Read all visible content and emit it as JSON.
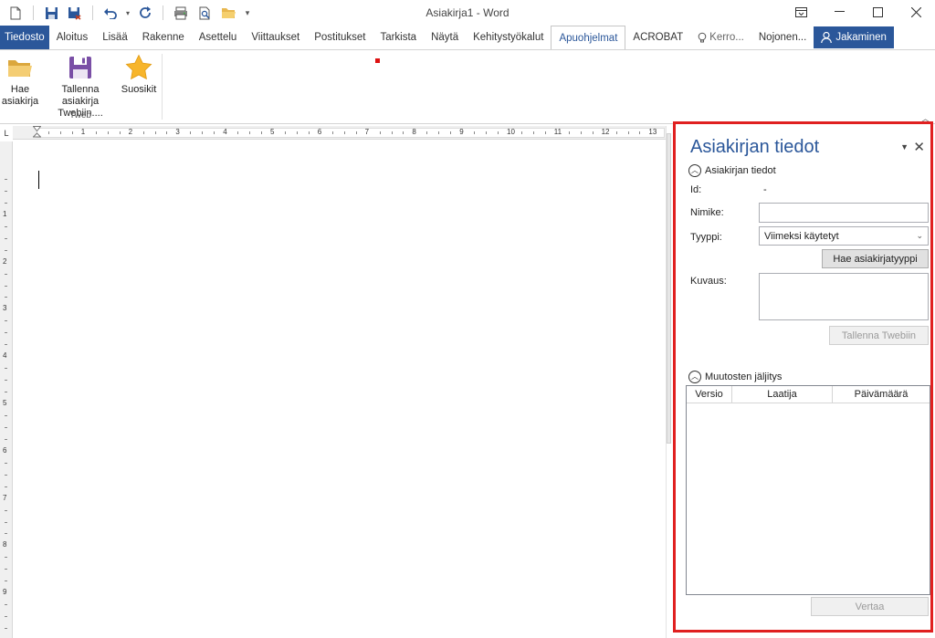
{
  "window": {
    "title": "Asiakirja1 - Word",
    "controls": [
      "ribbon-display-options",
      "minimize",
      "maximize",
      "close"
    ]
  },
  "quick_access": {
    "icons": [
      "new-document-icon",
      "save-icon",
      "save-as-icon",
      "undo-icon",
      "redo-icon",
      "print-icon",
      "print-preview-icon",
      "open-folder-icon",
      "customize-arrow-icon"
    ]
  },
  "ribbon_tabs": {
    "file": "Tiedosto",
    "items": [
      "Aloitus",
      "Lisää",
      "Rakenne",
      "Asettelu",
      "Viittaukset",
      "Postitukset",
      "Tarkista",
      "Näytä",
      "Kehitystyökalut"
    ],
    "active": "Apuohjelmat",
    "after": [
      "ACROBAT"
    ],
    "tell_me": "Kerro...",
    "user": "Nojonen...",
    "share": "Jakaminen"
  },
  "ribbon": {
    "buttons": [
      {
        "line1": "Hae",
        "line2": "asiakirja",
        "icon": "open-folder-icon"
      },
      {
        "line1": "Tallenna asiakirja",
        "line2": "Twebiin....",
        "icon": "save-floppy-icon"
      },
      {
        "line1": "Suosikit",
        "line2": "",
        "icon": "star-icon"
      }
    ],
    "group_label": "Tweb"
  },
  "ruler": {
    "h_numbers": [
      "1",
      "2",
      "3",
      "4",
      "5",
      "6",
      "7",
      "8",
      "9",
      "10",
      "11",
      "12",
      "13"
    ],
    "v_numbers": [
      "1",
      "2",
      "3",
      "4",
      "5",
      "6",
      "7",
      "8",
      "9"
    ],
    "corner": "L"
  },
  "pane": {
    "title": "Asiakirjan tiedot",
    "section1": "Asiakirjan tiedot",
    "id_label": "Id:",
    "id_value": "-",
    "name_label": "Nimike:",
    "name_value": "",
    "type_label": "Tyyppi:",
    "type_value": "Viimeksi käytetyt",
    "search_type_button": "Hae asiakirjatyyppi",
    "description_label": "Kuvaus:",
    "description_value": "",
    "save_button": "Tallenna Twebiin",
    "section2": "Muutosten jäljitys",
    "columns": [
      "Versio",
      "Laatija",
      "Päivämäärä"
    ],
    "rows": [],
    "compare_button": "Vertaa"
  },
  "colors": {
    "word_blue": "#2b579a",
    "pane_highlight": "#e02020"
  }
}
